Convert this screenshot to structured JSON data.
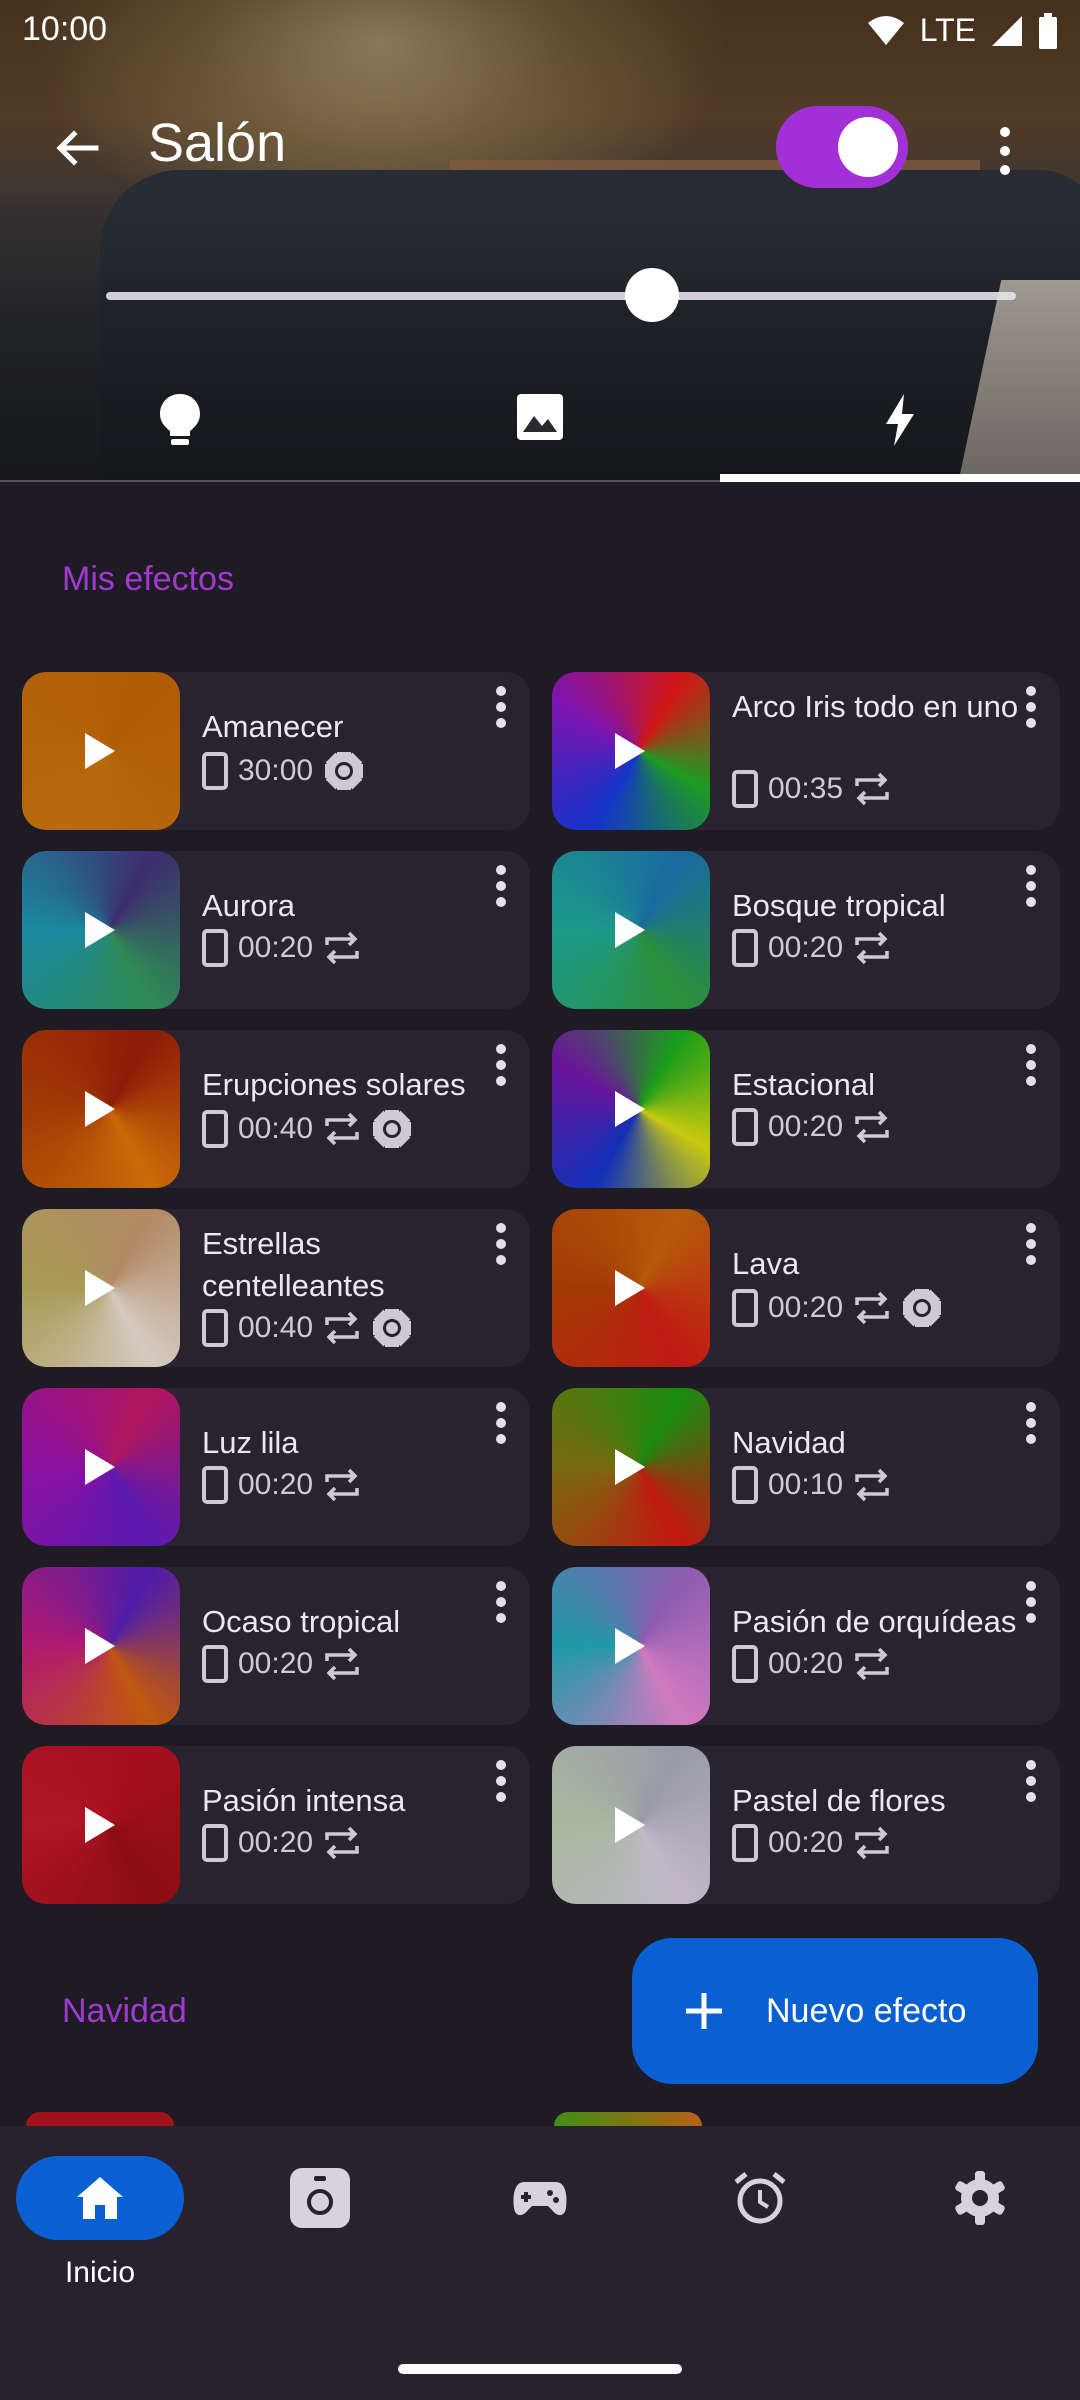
{
  "status_bar": {
    "time": "10:00",
    "network": "LTE"
  },
  "header": {
    "title": "Salón",
    "power_on": true,
    "brightness_fraction": 0.6,
    "tabs": [
      {
        "icon": "lightbulb-icon",
        "selected": false
      },
      {
        "icon": "image-icon",
        "selected": false
      },
      {
        "icon": "flash-icon",
        "selected": true
      }
    ]
  },
  "sections": [
    {
      "title": "Mis efectos"
    },
    {
      "title": "Navidad"
    }
  ],
  "effects": [
    {
      "name": "Amanecer",
      "duration": "30:00",
      "icons": [
        "phone-icon",
        "brightness-icon"
      ],
      "colors": [
        "#b05b06",
        "#b86a0c"
      ]
    },
    {
      "name": "Arco Iris todo en uno",
      "duration": "00:35",
      "icons": [
        "phone-icon",
        "repeat-icon"
      ],
      "colors": [
        "#d21616",
        "#1d9b22",
        "#1434c9",
        "#7b14b0"
      ]
    },
    {
      "name": "Aurora",
      "duration": "00:20",
      "icons": [
        "phone-icon",
        "repeat-icon"
      ],
      "colors": [
        "#3d2c6e",
        "#2f8a56",
        "#1a8aa0"
      ]
    },
    {
      "name": "Bosque tropical",
      "duration": "00:20",
      "icons": [
        "phone-icon",
        "repeat-icon"
      ],
      "colors": [
        "#1a6aa0",
        "#2c8f39",
        "#1c9a8a"
      ]
    },
    {
      "name": "Erupciones solares",
      "duration": "00:40",
      "icons": [
        "phone-icon",
        "repeat-icon",
        "brightness-icon"
      ],
      "colors": [
        "#8c1b08",
        "#c96a08",
        "#a23a05"
      ]
    },
    {
      "name": "Estacional",
      "duration": "00:20",
      "icons": [
        "phone-icon",
        "repeat-icon"
      ],
      "colors": [
        "#1a9d1a",
        "#c9c90f",
        "#1130b6",
        "#6a149a"
      ]
    },
    {
      "name": "Estrellas centelleantes",
      "duration": "00:40",
      "icons": [
        "phone-icon",
        "repeat-icon",
        "brightness-icon"
      ],
      "colors": [
        "#b28a66",
        "#d4c9c0",
        "#a99a55"
      ]
    },
    {
      "name": "Lava",
      "duration": "00:20",
      "icons": [
        "phone-icon",
        "repeat-icon",
        "brightness-icon"
      ],
      "colors": [
        "#b55a0a",
        "#c01a14",
        "#a23a05"
      ]
    },
    {
      "name": "Luz lila",
      "duration": "00:20",
      "icons": [
        "phone-icon",
        "repeat-icon"
      ],
      "colors": [
        "#b0165d",
        "#5a1ab0",
        "#8a11a0"
      ]
    },
    {
      "name": "Navidad",
      "duration": "00:10",
      "icons": [
        "phone-icon",
        "repeat-icon"
      ],
      "colors": [
        "#1a8a10",
        "#c01810",
        "#7a6a10"
      ]
    },
    {
      "name": "Ocaso tropical",
      "duration": "00:20",
      "icons": [
        "phone-icon",
        "repeat-icon"
      ],
      "colors": [
        "#4e1ca8",
        "#c0580f",
        "#b01a70"
      ]
    },
    {
      "name": "Pasión de orquídeas",
      "duration": "00:20",
      "icons": [
        "phone-icon",
        "repeat-icon"
      ],
      "colors": [
        "#8c5cb0",
        "#d07ac0",
        "#1f9aa8"
      ]
    },
    {
      "name": "Pasión intensa",
      "duration": "00:20",
      "icons": [
        "phone-icon",
        "repeat-icon"
      ],
      "colors": [
        "#a4101e",
        "#8a0d12",
        "#b01525"
      ]
    },
    {
      "name": "Pastel de flores",
      "duration": "00:20",
      "icons": [
        "phone-icon",
        "repeat-icon"
      ],
      "colors": [
        "#9a9aa8",
        "#c0b8c8",
        "#a8b8a0"
      ]
    }
  ],
  "fab": {
    "label": "Nuevo efecto"
  },
  "bottom_nav": [
    {
      "label": "Inicio",
      "icon": "home-icon",
      "selected": true
    },
    {
      "label": "",
      "icon": "camera-device-icon",
      "selected": false
    },
    {
      "label": "",
      "icon": "gamepad-icon",
      "selected": false
    },
    {
      "label": "",
      "icon": "alarm-icon",
      "selected": false
    },
    {
      "label": "",
      "icon": "settings-icon",
      "selected": false
    }
  ],
  "colors": {
    "accent_purple": "#a13bd0",
    "primary_blue": "#0a5fd3",
    "surface": "#28232e"
  }
}
